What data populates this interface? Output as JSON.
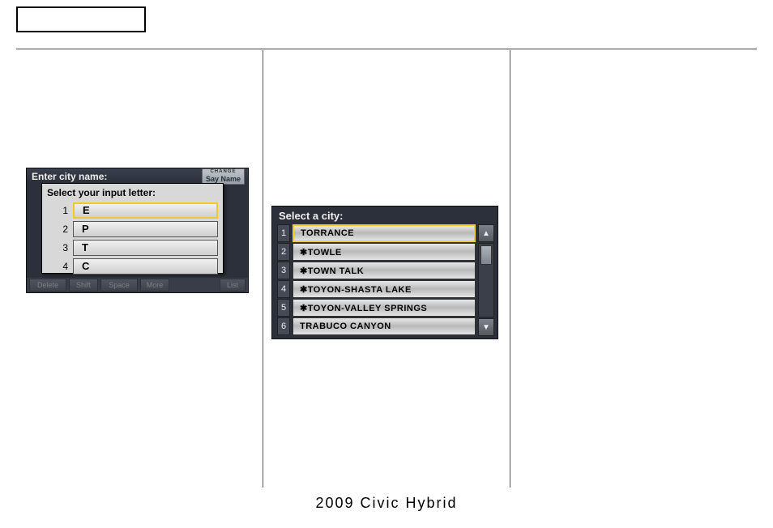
{
  "footer": "2009  Civic  Hybrid",
  "ss1": {
    "bgTitle": "Enter city name:",
    "sayNameTiny": "CHANGE",
    "sayName": "Say Name",
    "popupTitle": "Select your input letter:",
    "options": [
      {
        "n": "1",
        "v": "E",
        "sel": true
      },
      {
        "n": "2",
        "v": "P",
        "sel": false
      },
      {
        "n": "3",
        "v": "T",
        "sel": false
      },
      {
        "n": "4",
        "v": "C",
        "sel": false
      }
    ],
    "bottom": {
      "delete": "Delete",
      "shift": "Shift",
      "space": "Space",
      "more": "More",
      "list": "List"
    }
  },
  "ss2": {
    "title": "Select a city:",
    "items": [
      {
        "n": "1",
        "v": "TORRANCE",
        "sel": true
      },
      {
        "n": "2",
        "v": "✱TOWLE",
        "sel": false
      },
      {
        "n": "3",
        "v": "✱TOWN TALK",
        "sel": false
      },
      {
        "n": "4",
        "v": "✱TOYON-SHASTA LAKE",
        "sel": false
      },
      {
        "n": "5",
        "v": "✱TOYON-VALLEY SPRINGS",
        "sel": false
      },
      {
        "n": "6",
        "v": "TRABUCO CANYON",
        "sel": false
      }
    ],
    "up": "▲",
    "down": "▼"
  }
}
